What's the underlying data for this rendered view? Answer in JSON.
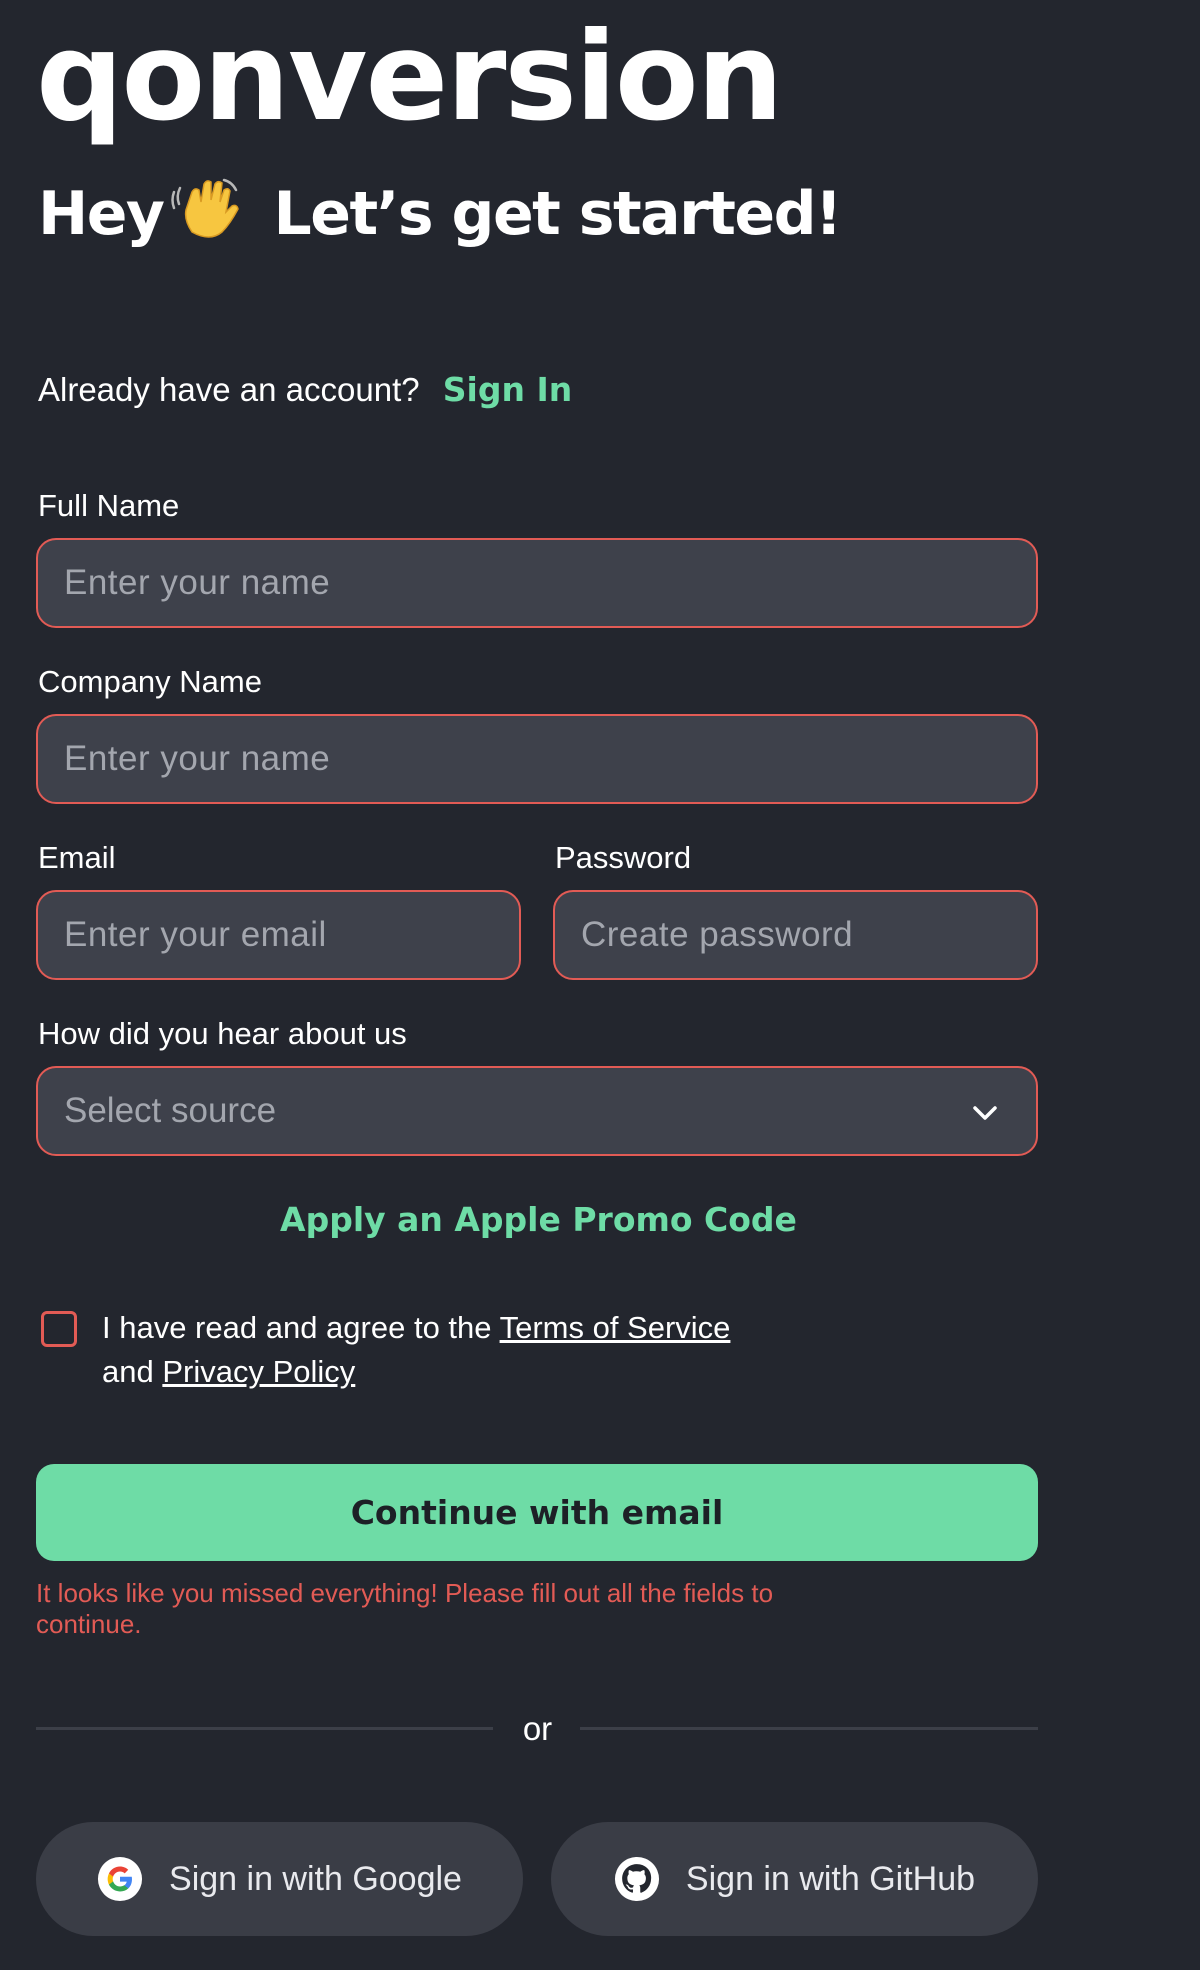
{
  "brand": {
    "logo_text": "qonversion"
  },
  "header": {
    "greeting": "Hey",
    "greeting_emoji": "waving-hand-icon",
    "title": "Let’s get started!"
  },
  "account_prompt": {
    "text": "Already have an account?",
    "signin_label": "Sign In"
  },
  "form": {
    "full_name": {
      "label": "Full Name",
      "placeholder": "Enter your name",
      "value": ""
    },
    "company_name": {
      "label": "Company Name",
      "placeholder": "Enter your name",
      "value": ""
    },
    "email": {
      "label": "Email",
      "placeholder": "Enter your email",
      "value": ""
    },
    "password": {
      "label": "Password",
      "placeholder": "Create password",
      "value": ""
    },
    "source": {
      "label": "How did you hear about us",
      "selected": "Select source",
      "icon": "chevron-down-icon"
    }
  },
  "promo_link": "Apply an Apple Promo Code",
  "terms": {
    "prefix": "I have read and agree to the",
    "tos_label": "Terms of Service",
    "joiner": "and",
    "privacy_label": "Privacy Policy",
    "checked": false
  },
  "continue_button": "Continue with email",
  "error_message": "It looks like you missed everything! Please fill out all the fields to continue.",
  "divider_text": "or",
  "social": {
    "google_label": "Sign in with Google",
    "google_icon": "google-icon",
    "github_label": "Sign in with GitHub",
    "github_icon": "github-icon"
  },
  "colors": {
    "background": "#23262e",
    "field_background": "#3e414b",
    "error_border": "#e25b55",
    "accent_green": "#6edca6",
    "social_button": "#3a3d46"
  }
}
